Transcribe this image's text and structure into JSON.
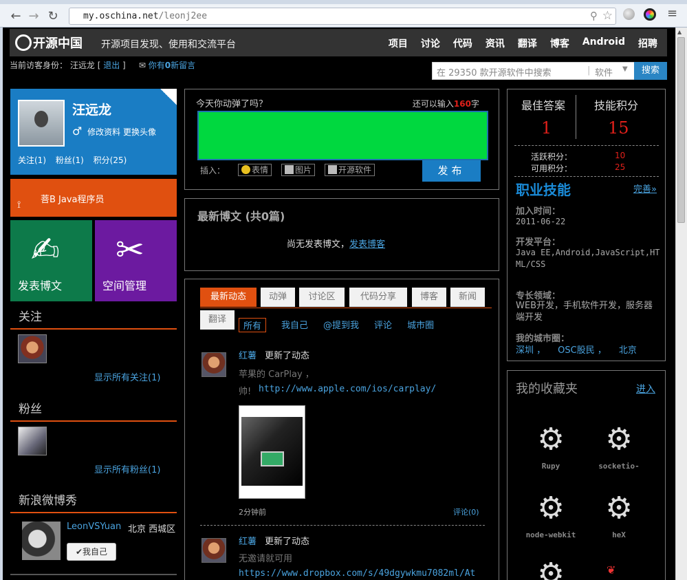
{
  "browser": {
    "url_host": "my.oschina.net",
    "url_path": "/leonj2ee"
  },
  "header": {
    "logo": "开源中国",
    "slogan": "开源项目发现、使用和交流平台",
    "nav": [
      "项目",
      "讨论",
      "代码",
      "资讯",
      "翻译",
      "博客",
      "Android",
      "招聘"
    ]
  },
  "userline": {
    "prefix": "当前访客身份：",
    "name": "汪远龙",
    "bracket_open": "[",
    "logout": "退出",
    "bracket_close": "]",
    "msg_pre": "你有",
    "msg_count": "0",
    "msg_post": "新留言"
  },
  "search": {
    "placeholder": "在 29350 款开源软件中搜索",
    "category": "软件",
    "button": "搜索"
  },
  "profile": {
    "name": "汪远龙",
    "edit": "修改资料",
    "avatar": "更换头像",
    "follow": "关注(1)",
    "fans": "粉丝(1)",
    "score": "积分(25)"
  },
  "rank": {
    "label": "菩B Java程序员"
  },
  "tiles": {
    "post_blog": "发表博文",
    "space_mgmt": "空间管理"
  },
  "follow": {
    "title": "关注",
    "show_all": "显示所有关注(1)"
  },
  "fans": {
    "title": "粉丝",
    "show_all": "显示所有粉丝(1)"
  },
  "weibo": {
    "title": "新浪微博秀",
    "name": "LeonVSYuan",
    "location": "北京 西城区",
    "button": "✔我自己"
  },
  "post": {
    "question": "今天你动弹了吗？",
    "count_pre": "还可以输入",
    "count_num": "160",
    "count_post": "字",
    "insert": "插入：",
    "emoji": "表情",
    "image": "图片",
    "software": "开源软件",
    "publish": "发布"
  },
  "blog": {
    "title": "最新博文 (共0篇)",
    "empty": "尚无发表博文，",
    "empty_link": "发表博客"
  },
  "feed": {
    "tabs": [
      "最新动态",
      "动弹",
      "讨论区",
      "代码分享",
      "博客",
      "新闻",
      "翻译"
    ],
    "subtabs": [
      "所有",
      "我自己",
      "@提到我",
      "评论",
      "城市圈"
    ],
    "items": [
      {
        "user": "红薯",
        "action": "更新了动态",
        "line1": "苹果的 CarPlay ，",
        "line2_pre": "帅!",
        "link": "http://www.apple.com/ios/carplay/",
        "time": "2分钟前",
        "comment": "评论(0)"
      },
      {
        "user": "红薯",
        "action": "更新了动态",
        "line1": "无邀请就可用",
        "link": "https://www.dropbox.com/s/49dgywkmu7082ml/At"
      }
    ]
  },
  "stats": {
    "best_answer_label": "最佳答案",
    "best_answer": "1",
    "skill_score_label": "技能积分",
    "skill_score": "15",
    "active_label": "活跃积分：",
    "active": "10",
    "usable_label": "可用积分：",
    "usable": "25"
  },
  "skills": {
    "title": "职业技能",
    "more": "完善»",
    "join_label": "加入时间：",
    "join": "2011-06-22",
    "platform_label": "开发平台：",
    "platform": "Java EE,Android,JavaScript,HTML/CSS",
    "domain_label": "专长领域：",
    "domain": "WEB开发，手机软件开发，服务器端开发",
    "city_label": "我的城市圈：",
    "cities": [
      "深圳 ，",
      "OSC股民 ，",
      "北京"
    ]
  },
  "favorites": {
    "title": "我的收藏夹",
    "enter": "进入",
    "items": [
      "Rupy",
      "socketio-",
      "node-webkit",
      "heX"
    ]
  },
  "colors": {
    "accent_orange": "#e05010",
    "profile_blue": "#1a7dc4",
    "tile_green": "#0d7a4a",
    "tile_purple": "#6c1aa0",
    "post_green": "#00d83f",
    "link_blue": "#4aa3df",
    "red": "#e0201a"
  }
}
